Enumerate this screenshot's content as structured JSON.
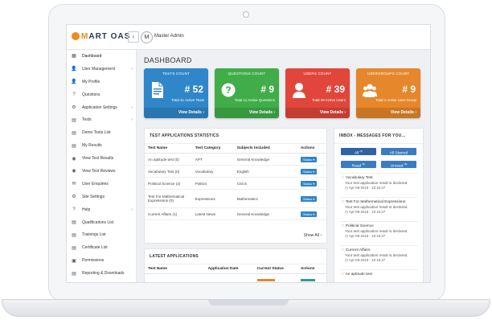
{
  "app": {
    "logo_text_1": "M",
    "logo_text_2": "ART OAS",
    "admin_initial": "M",
    "admin_name": "Master Admin"
  },
  "sidebar": {
    "items": [
      {
        "label": "Dashboard",
        "icon": "dashboard-icon",
        "glyph": "▦",
        "chevron": ""
      },
      {
        "label": "User Management",
        "icon": "users-icon",
        "glyph": "👤",
        "chevron": "›"
      },
      {
        "label": "My Profile",
        "icon": "user-icon",
        "glyph": "👤",
        "chevron": ""
      },
      {
        "label": "Questions",
        "icon": "question-icon",
        "glyph": "?",
        "chevron": ""
      },
      {
        "label": "Application Settings",
        "icon": "gear-icon",
        "glyph": "⚙",
        "chevron": "›"
      },
      {
        "label": "Tests",
        "icon": "tests-icon",
        "glyph": "▤",
        "chevron": "›"
      },
      {
        "label": "Demo Tests List",
        "icon": "list-icon",
        "glyph": "▤",
        "chevron": ""
      },
      {
        "label": "My Results",
        "icon": "results-icon",
        "glyph": "▤",
        "chevron": ""
      },
      {
        "label": "View Test Results",
        "icon": "eye-icon",
        "glyph": "◉",
        "chevron": ""
      },
      {
        "label": "View Test Reviews",
        "icon": "eye-icon",
        "glyph": "◉",
        "chevron": ""
      },
      {
        "label": "User Enquiries",
        "icon": "enquiry-icon",
        "glyph": "✉",
        "chevron": ""
      },
      {
        "label": "Site Settings",
        "icon": "gear-icon",
        "glyph": "⚙",
        "chevron": ""
      },
      {
        "label": "Help",
        "icon": "help-icon",
        "glyph": "?",
        "chevron": "›"
      },
      {
        "label": "Qualifications List",
        "icon": "list-icon",
        "glyph": "▤",
        "chevron": ""
      },
      {
        "label": "Trainings List",
        "icon": "list-icon",
        "glyph": "▤",
        "chevron": ""
      },
      {
        "label": "Certificate List",
        "icon": "list-icon",
        "glyph": "▤",
        "chevron": ""
      },
      {
        "label": "Permissions",
        "icon": "lock-icon",
        "glyph": "▣",
        "chevron": ""
      },
      {
        "label": "Reporting & Downloads",
        "icon": "download-icon",
        "glyph": "▤",
        "chevron": ""
      }
    ]
  },
  "dashboard": {
    "title": "DASHBOARD"
  },
  "cards": [
    {
      "title": "TESTS COUNT",
      "value": "# 52",
      "subtitle": "Total 41 Active Tests",
      "link": "View Details ›",
      "color": "#2f86c9",
      "icon": "document-icon"
    },
    {
      "title": "QUESTIONS COUNT",
      "value": "# 9",
      "subtitle": "Total 11 Active Questions",
      "link": "View Details ›",
      "color": "#40ad48",
      "icon": "question-circle-icon"
    },
    {
      "title": "USERS COUNT",
      "value": "# 39",
      "subtitle": "Total 39 Active Users",
      "link": "View Details ›",
      "color": "#e0463a",
      "icon": "user-icon"
    },
    {
      "title": "USERGROUPS COUNT",
      "value": "# 9",
      "subtitle": "Total 1 Active User Group",
      "link": "View Details ›",
      "color": "#e5872a",
      "icon": "group-icon"
    }
  ],
  "stats": {
    "title": "TEST APPLICATIONS STATISTICS",
    "headers": [
      "Test Name",
      "Test Category",
      "Subjects Included",
      "Actions"
    ],
    "rows": [
      [
        "An aptitude test (0)",
        "APT",
        "General Knowledge",
        "Status ▾"
      ],
      [
        "Vocabulary Test (0)",
        "Vocabulary",
        "English",
        "Status ▾"
      ],
      [
        "Political Science (2)",
        "Politics",
        "Civics",
        "Status ▾"
      ],
      [
        "Test For Mathematical Expressions (0)",
        "Expressions",
        "Mathematics",
        "Status ▾"
      ],
      [
        "Current Affairs (1)",
        "Latest News",
        "General Knowledge",
        "Status ▾"
      ]
    ],
    "show_all": "Show All ›"
  },
  "latest": {
    "title": "LATEST APPLICATIONS",
    "headers": [
      "Test Name",
      "Application Date",
      "Current Status",
      "Actions"
    ]
  },
  "inbox": {
    "title": "INBOX - MESSAGES FOR YOU...",
    "tabs": [
      "All",
      "All Starred",
      "Read",
      "Unread"
    ],
    "tab_counts": [
      "(5)",
      "",
      "(0)",
      "(5)"
    ],
    "messages": [
      {
        "title": "Vocabulary Test",
        "body": "Your test application result is declared.",
        "date": "Apr-08-2019 - 10:15:27"
      },
      {
        "title": "Test For Mathematical Expressions",
        "body": "Your test application result is declared.",
        "date": "Apr-08-2019 - 10:15:27"
      },
      {
        "title": "Political Science",
        "body": "Your test application result is declared.",
        "date": "Apr-08-2019 - 10:15:27"
      },
      {
        "title": "Current Affairs",
        "body": "Your test application result is declared.",
        "date": "Apr-08-2019 - 10:15:27"
      },
      {
        "title": "An aptitude test",
        "body": "",
        "date": ""
      }
    ]
  }
}
